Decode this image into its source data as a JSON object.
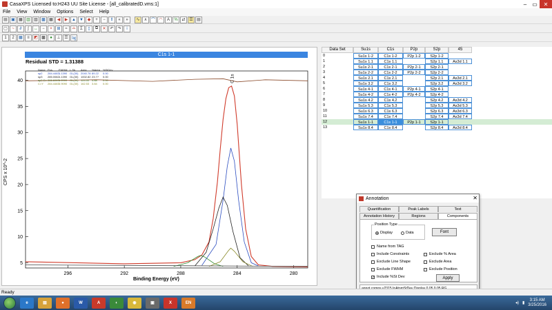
{
  "window": {
    "title": "CasaXPS Licensed to:H243 UU Site License - [all_calibratedD.vms:1]"
  },
  "menu": [
    "File",
    "View",
    "Window",
    "Options",
    "Select",
    "Help"
  ],
  "graph": {
    "header": "C1s 1-1",
    "residual": "Residual STD = 1.31388",
    "peak_label": "C 1s",
    "ylabel": "CPS x 10^-2",
    "xlabel": "Binding Energy (eV)",
    "table_header": [
      "Name",
      "Pos.",
      "FWHM",
      "L.Sh.",
      "Area",
      "%Area",
      "%StDev"
    ],
    "table_rows": [
      [
        "sp2",
        "284.4483",
        "1.1390",
        "GL(30)",
        "2040.78",
        "89.22",
        "0.00"
      ],
      [
        "sp3",
        "285.0082",
        "1.1390",
        "GL(30)",
        "1002.82",
        "23.7?",
        "0.00"
      ],
      [
        "sp3-Ex",
        "286.6063",
        "1.2000",
        "GL(30)",
        "124.00",
        "4.88",
        "0.00"
      ],
      [
        "C=Y",
        "284.4483",
        "0.9090",
        "GL(30)",
        "162.53",
        "3.84",
        "0.00"
      ]
    ]
  },
  "chart_data": {
    "type": "line",
    "xlabel": "Binding Energy (eV)",
    "ylabel": "CPS x 10^-2",
    "x_reversed": true,
    "xlim": [
      299,
      279
    ],
    "ylim": [
      4,
      41
    ],
    "x_ticks": [
      296,
      292,
      288,
      284,
      280
    ],
    "y_ticks": [
      5,
      10,
      15,
      20,
      25,
      30,
      35,
      40
    ],
    "series": [
      {
        "name": "envelope",
        "color": "#d03a2a",
        "x": [
          299,
          292,
          288,
          287,
          286.5,
          286,
          285.7,
          285.4,
          285.2,
          285.0,
          284.8,
          284.6,
          284.4,
          284.2,
          284.0,
          283.7,
          283.4,
          283.0,
          282.5,
          281.5,
          279
        ],
        "y": [
          5.2,
          4.8,
          5.0,
          5.6,
          6.5,
          9.0,
          13.5,
          20.5,
          26.8,
          32.5,
          36.5,
          38.6,
          38.9,
          37.0,
          31.5,
          20.0,
          11.5,
          6.2,
          4.6,
          4.3,
          4.2
        ]
      },
      {
        "name": "sp2",
        "color": "#2a4cc0",
        "x": [
          286.5,
          285.5,
          285.0,
          284.7,
          284.45,
          284.2,
          283.9,
          283.5,
          283.0,
          282.5
        ],
        "y": [
          4.5,
          8.5,
          17.0,
          23.5,
          27.0,
          24.5,
          17.0,
          9.0,
          5.0,
          4.4
        ]
      },
      {
        "name": "sp3",
        "color": "#222222",
        "x": [
          287.0,
          286.2,
          285.7,
          285.3,
          285.0,
          284.7,
          284.3,
          283.8,
          283.2
        ],
        "y": [
          4.4,
          7.0,
          11.5,
          15.5,
          17.6,
          16.0,
          11.0,
          6.0,
          4.4
        ]
      },
      {
        "name": "sp3-Ex",
        "color": "#2e8b2e",
        "x": [
          288.5,
          287.5,
          286.8,
          286.6,
          286.3,
          285.6,
          285.0
        ],
        "y": [
          4.3,
          5.0,
          6.2,
          6.4,
          6.1,
          4.8,
          4.3
        ]
      },
      {
        "name": "C=Y",
        "color": "#8a8a2a",
        "x": [
          286.0,
          285.2,
          284.6,
          284.45,
          284.2,
          283.6,
          282.9
        ],
        "y": [
          4.3,
          5.2,
          7.4,
          7.8,
          7.2,
          5.2,
          4.3
        ]
      },
      {
        "name": "background",
        "color": "#444444",
        "x": [
          299,
          279
        ],
        "y": [
          4.6,
          4.3
        ]
      },
      {
        "name": "residual",
        "color": "#8a4a2a",
        "x": [
          299,
          294,
          290,
          287,
          285,
          284,
          282,
          279
        ],
        "y": [
          39.9,
          40.1,
          39.8,
          40.2,
          40.3,
          39.7,
          40.1,
          39.9
        ]
      }
    ]
  },
  "grid": {
    "headers": [
      "Data Set",
      "Su1s",
      "C1s",
      "P2p",
      "S2p",
      "45"
    ],
    "rows": [
      [
        "0",
        "Su1s 1-2",
        "C1s 1-2",
        "P2p 1-2",
        "S2p 1-2",
        ""
      ],
      [
        "1",
        "Su1s 1.1",
        "C1s 1.1",
        "",
        "S2p 1.1",
        "As3d 1.1"
      ],
      [
        "2",
        "Su1s 2-1",
        "C1s 2-1",
        "P2p 2-1",
        "S2p 2-1",
        ""
      ],
      [
        "3",
        "Su1s 2-2",
        "C1s 2-2",
        "P2p 2-2",
        "S2p 2-2",
        ""
      ],
      [
        "4",
        "Su1s 2.1",
        "C1s 2.1",
        "",
        "S2p 2.1",
        "As3d 2.1"
      ],
      [
        "5",
        "Su1s 3.2",
        "C1s 3.2",
        "",
        "S2p 3.2",
        "As3d 3.2"
      ],
      [
        "6",
        "Su1s 4-1",
        "C1s 4-1",
        "P2p 4-1",
        "S2p 4-1",
        ""
      ],
      [
        "7",
        "Su1s 4-2",
        "C1s 4-2",
        "P2p 4-2",
        "S2p 4-2",
        ""
      ],
      [
        "8",
        "Su1s 4.2",
        "C1s 4.2",
        "",
        "S2p 4.2",
        "As3d 4.2"
      ],
      [
        "9",
        "Su1s 5.3",
        "C1s 5.3",
        "",
        "S2p 5.3",
        "As3d 5.3"
      ],
      [
        "10",
        "Su1s 6.3",
        "C1s 6.3",
        "",
        "S2p 6.3",
        "As3d 6.3"
      ],
      [
        "11",
        "Su1s 7.4",
        "C1s 7.4",
        "",
        "S2p 7.4",
        "As3d 7.4"
      ],
      [
        "12",
        "Su1s 1-1",
        "C1s 1-1",
        "P2p 1-1",
        "S2p 1-1",
        ""
      ],
      [
        "13",
        "Su1s 8.4",
        "C1s 8.4",
        "",
        "S2p 8.4",
        "As3d 8.4"
      ]
    ],
    "selected_row": 12
  },
  "dialog": {
    "title": "Annotation",
    "tabs_row1": [
      "Quantification",
      "Peak Labels",
      "Text"
    ],
    "tabs_row2": [
      "Annotation History",
      "Regions",
      "Components"
    ],
    "position_type_label": "Position Type",
    "radio_display": "Display",
    "radio_data": "Data",
    "font_button": "Font",
    "checks_left": [
      "Name from TAG",
      "Include Constraints",
      "Exclude Line Shape",
      "Exclude FWHM",
      "Include %St Dev"
    ],
    "checks_right": [
      "Exclude % Area",
      "Exclude Area",
      "Exclude Position"
    ],
    "apply_button": "Apply",
    "status": "annot comps v2315 InAtomStDev Display 0.05 0.05 RG"
  },
  "status": {
    "text": "Ready"
  },
  "taskbar": {
    "apps": [
      "IE",
      "Explorer",
      "Firefox",
      "Word",
      "Acrobat",
      "App",
      "Chrome",
      "App2",
      "CasaXPS",
      "EN"
    ],
    "time": "3:15 AM",
    "date": "3/25/2016"
  }
}
